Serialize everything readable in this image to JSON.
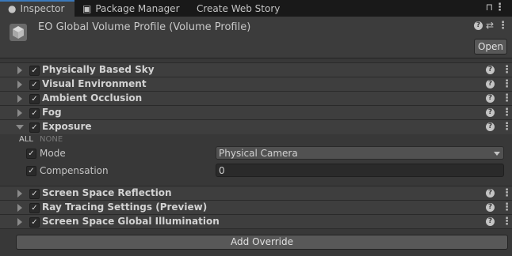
{
  "tabs": [
    {
      "label": "Inspector",
      "icon": "info-icon",
      "active": true
    },
    {
      "label": "Package Manager",
      "icon": "package-icon",
      "active": false
    },
    {
      "label": "Create Web Story",
      "active": false
    }
  ],
  "header": {
    "title": "EO Global Volume Profile (Volume Profile)",
    "open_label": "Open"
  },
  "sections_top": [
    {
      "label": "Physically Based Sky",
      "checked": true
    },
    {
      "label": "Visual Environment",
      "checked": true
    },
    {
      "label": "Ambient Occlusion",
      "checked": true
    },
    {
      "label": "Fog",
      "checked": true
    },
    {
      "label": "Exposure",
      "checked": true,
      "expanded": true
    }
  ],
  "exposure": {
    "all_label": "ALL",
    "none_label": "NONE",
    "mode_label": "Mode",
    "mode_value": "Physical Camera",
    "compensation_label": "Compensation",
    "compensation_value": "0"
  },
  "sections_bottom": [
    {
      "label": "Screen Space Reflection",
      "checked": true
    },
    {
      "label": "Ray Tracing Settings (Preview)",
      "checked": true
    },
    {
      "label": "Screen Space Global Illumination",
      "checked": true
    }
  ],
  "add_override_label": "Add Override",
  "colors": {
    "background": "#383838",
    "accent": "#3a79bb"
  }
}
